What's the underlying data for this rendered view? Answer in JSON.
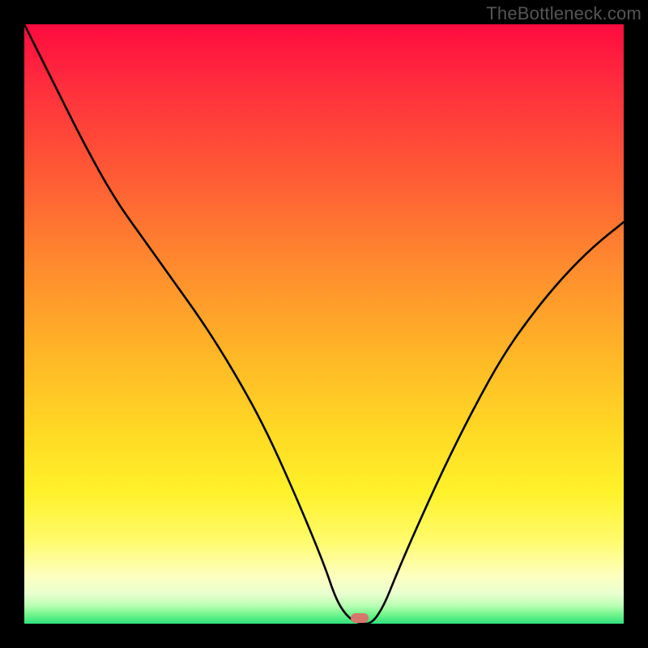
{
  "watermark": "TheBottleneck.com",
  "marker": {
    "x_pct": 56,
    "y_pct": 99
  },
  "chart_data": {
    "type": "line",
    "title": "",
    "xlabel": "",
    "ylabel": "",
    "xlim": [
      0,
      100
    ],
    "ylim": [
      0,
      100
    ],
    "axes_visible": false,
    "grid": false,
    "background_gradient": {
      "direction": "vertical",
      "stops": [
        {
          "pos": 0,
          "color": "#ff0b3f"
        },
        {
          "pos": 40,
          "color": "#ff8a2e"
        },
        {
          "pos": 78,
          "color": "#fff12a"
        },
        {
          "pos": 95,
          "color": "#e9ffcf"
        },
        {
          "pos": 100,
          "color": "#2fe07d"
        }
      ]
    },
    "x": [
      0,
      5,
      10,
      15,
      20,
      25,
      30,
      35,
      40,
      45,
      50,
      52,
      54,
      56,
      58,
      60,
      62,
      65,
      70,
      75,
      80,
      85,
      90,
      95,
      100
    ],
    "series": [
      {
        "name": "bottleneck-curve",
        "values": [
          100,
          90,
          80,
          71,
          64,
          57,
          50,
          42,
          33,
          22,
          10,
          4,
          1,
          0,
          0,
          3,
          8,
          15,
          26,
          36,
          45,
          52,
          58,
          63,
          67
        ]
      }
    ],
    "annotations": [
      {
        "type": "marker",
        "x": 56,
        "y": 0,
        "color": "#d6776d"
      }
    ]
  }
}
